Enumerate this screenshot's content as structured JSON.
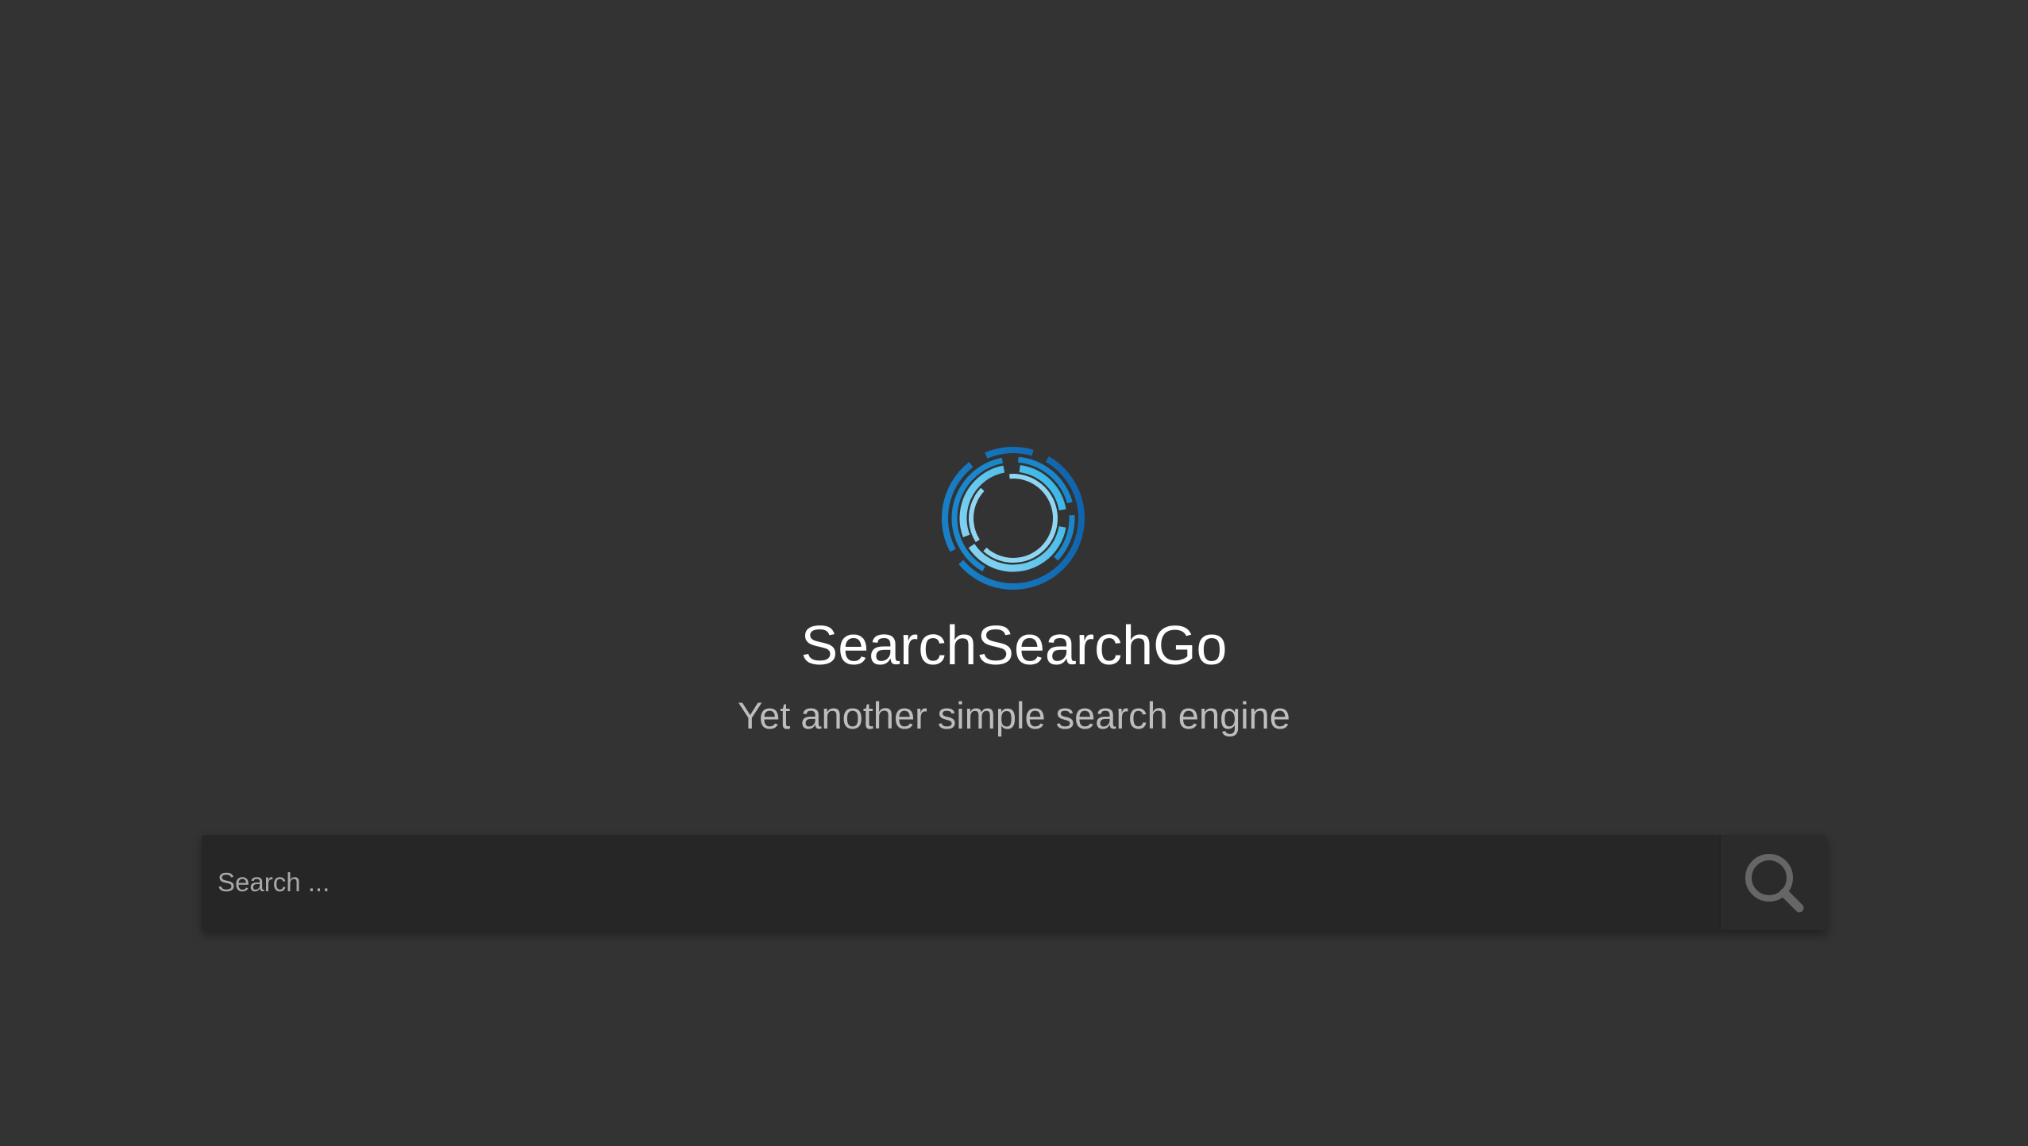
{
  "app": {
    "title": "SearchSearchGo",
    "tagline": "Yet another simple search engine"
  },
  "logo": {
    "icon": "ring-logo-icon",
    "colors": [
      "#0d5fa8",
      "#1a86cc",
      "#2fb4e6",
      "#8fd6f2"
    ]
  },
  "search": {
    "placeholder": "Search ...",
    "value": "",
    "button_icon": "search-icon",
    "button_icon_color": "#666666"
  },
  "colors": {
    "background": "#333333",
    "input_background": "#262626",
    "title": "#ffffff",
    "tagline": "#bdbdbd"
  }
}
